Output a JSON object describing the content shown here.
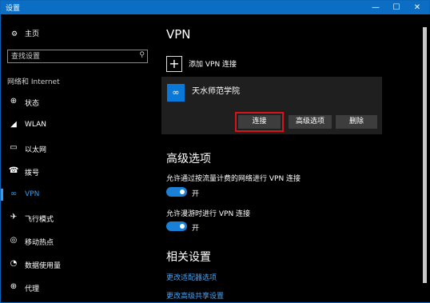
{
  "window": {
    "title": "设置",
    "minimize": "—",
    "maximize": "☐",
    "close": "✕"
  },
  "sidebar": {
    "home": {
      "label": "主页",
      "icon": "gear-icon"
    },
    "search": {
      "placeholder": "查找设置",
      "icon": "search-icon"
    },
    "section_label": "网络和 Internet",
    "items": [
      {
        "label": "状态",
        "icon": "globe-icon"
      },
      {
        "label": "WLAN",
        "icon": "wifi-icon"
      },
      {
        "label": "以太网",
        "icon": "ethernet-icon"
      },
      {
        "label": "拨号",
        "icon": "dialup-icon"
      },
      {
        "label": "VPN",
        "icon": "vpn-icon",
        "active": true
      },
      {
        "label": "飞行模式",
        "icon": "airplane-icon"
      },
      {
        "label": "移动热点",
        "icon": "hotspot-icon"
      },
      {
        "label": "数据使用量",
        "icon": "data-usage-icon"
      },
      {
        "label": "代理",
        "icon": "proxy-globe-icon"
      }
    ]
  },
  "main": {
    "title": "VPN",
    "add_vpn_label": "添加 VPN 连接",
    "vpn": {
      "name": "天水师范学院",
      "connect": "连接",
      "advanced": "高级选项",
      "delete": "删除"
    },
    "advanced_title": "高级选项",
    "options": [
      {
        "label": "允许通过按流量计费的网络进行 VPN 连接",
        "state": "开",
        "on": true
      },
      {
        "label": "允许漫游时进行 VPN 连接",
        "state": "开",
        "on": true
      }
    ],
    "related_title": "相关设置",
    "links": [
      "更改适配器选项",
      "更改高级共享设置"
    ]
  },
  "colors": {
    "titlebar": "#0b6dc3",
    "accent": "#3b9ae8",
    "highlight": "#d8141b"
  }
}
